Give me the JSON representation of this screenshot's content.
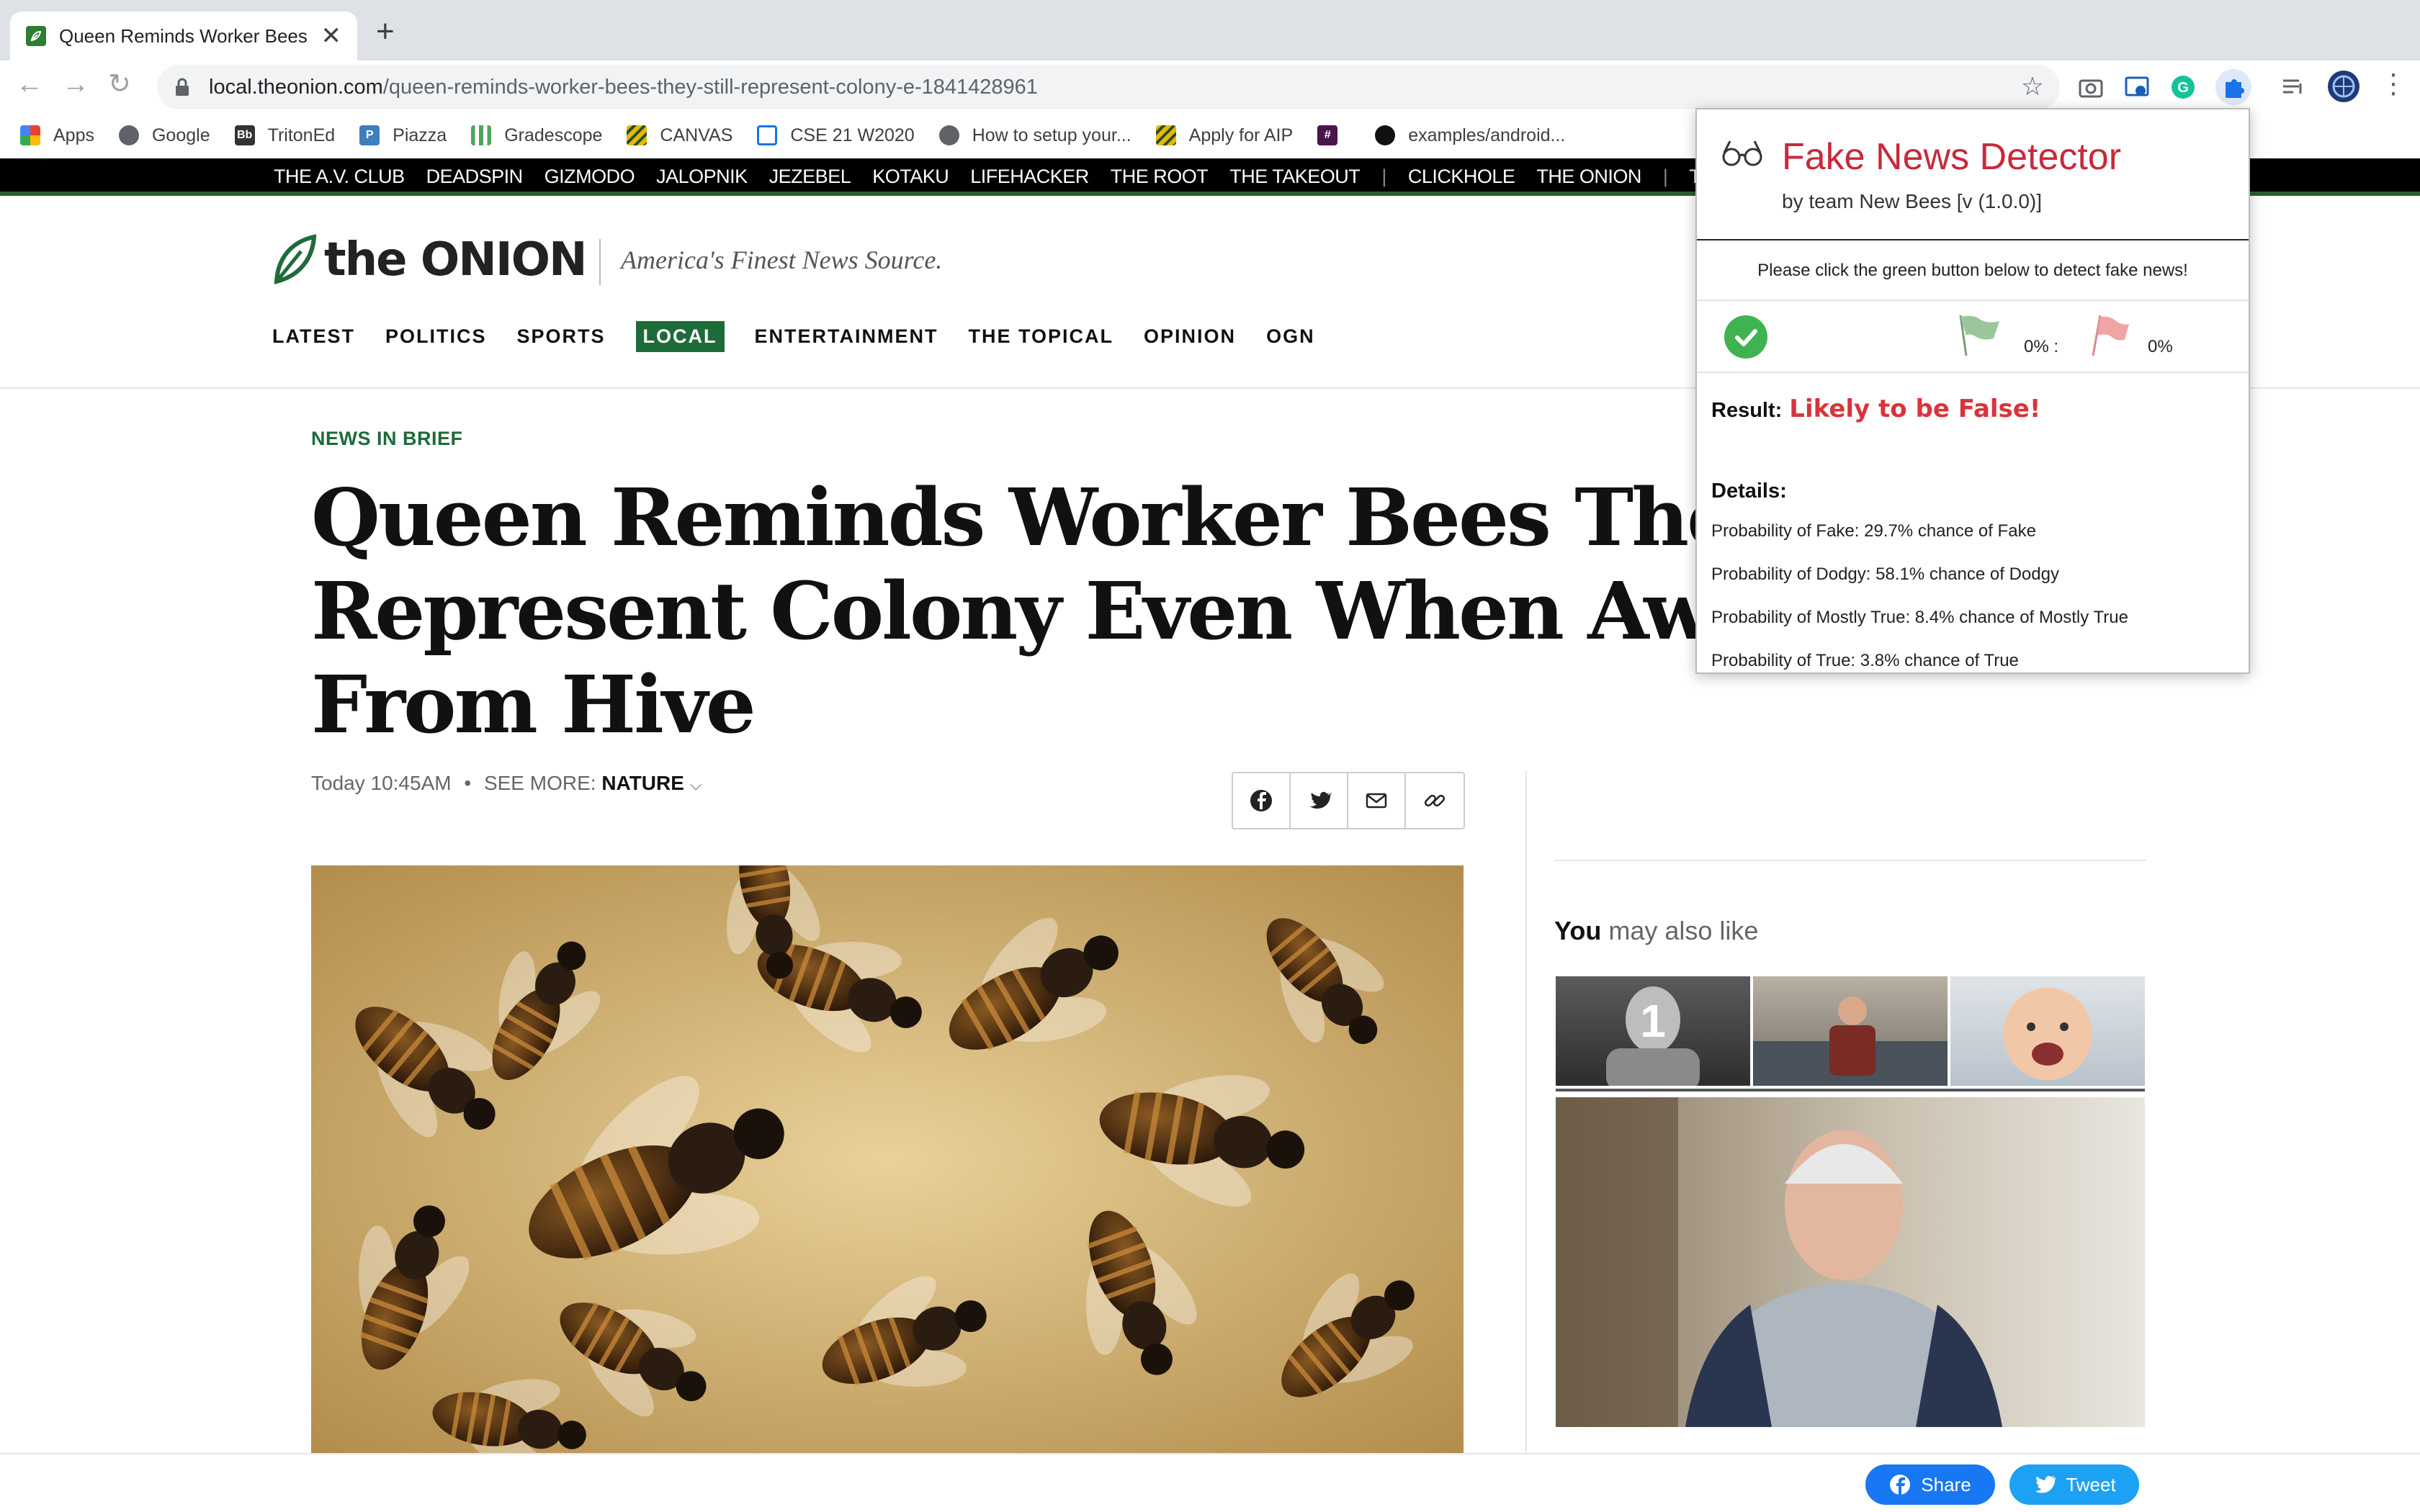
{
  "browser": {
    "tab_title": "Queen Reminds Worker Bees T",
    "tab_close": "✕",
    "new_tab": "+",
    "url_domain": "local.theonion.com",
    "url_path": "/queen-reminds-worker-bees-they-still-represent-colony-e-1841428961",
    "bookmarks": [
      {
        "label": "Apps",
        "icon": "apps-grid-icon",
        "color": "#e94235"
      },
      {
        "label": "Google",
        "icon": "globe-icon",
        "color": "#5f6368"
      },
      {
        "label": "TritonEd",
        "icon": "tritoned-icon",
        "color": "#333333"
      },
      {
        "label": "Piazza",
        "icon": "piazza-icon",
        "color": "#3e7ebd"
      },
      {
        "label": "Gradescope",
        "icon": "bar-chart-icon",
        "color": "#4ea55c"
      },
      {
        "label": "CANVAS",
        "icon": "canvas-icon",
        "color": "#e6b800"
      },
      {
        "label": "CSE 21 W2020",
        "icon": "table-icon",
        "color": "#1a73e8"
      },
      {
        "label": "How to setup your...",
        "icon": "globe-icon",
        "color": "#5f6368"
      },
      {
        "label": "Apply for AIP",
        "icon": "canvas-icon",
        "color": "#e6b800"
      },
      {
        "label": "",
        "icon": "slack-icon",
        "color": "#4a154b"
      },
      {
        "label": "examples/android...",
        "icon": "github-icon",
        "color": "#111111"
      }
    ]
  },
  "network_links": [
    "THE A.V. CLUB",
    "DEADSPIN",
    "GIZMODO",
    "JALOPNIK",
    "JEZEBEL",
    "KOTAKU",
    "LIFEHACKER",
    "THE ROOT",
    "THE TAKEOUT",
    "|",
    "CLICKHOLE",
    "THE ONION",
    "|",
    "THE INVENTORY"
  ],
  "site": {
    "logo_text": "the ONION",
    "tagline": "America's Finest News Source.",
    "nav": [
      "LATEST",
      "POLITICS",
      "SPORTS",
      "LOCAL",
      "ENTERTAINMENT",
      "THE TOPICAL",
      "OPINION",
      "OGN"
    ],
    "nav_active": "LOCAL"
  },
  "article": {
    "kicker": "NEWS IN BRIEF",
    "headline": "Queen Reminds Worker Bees They Still Represent Colony Even When Away From Hive",
    "time": "Today 10:45AM",
    "bullet": "•",
    "see_more_label": "SEE MORE:",
    "see_more_tag": "NATURE"
  },
  "sidebar": {
    "related_you": "You",
    "related_rest": " may also like",
    "badge_number": "1"
  },
  "bottom_share": {
    "share_label": "Share",
    "tweet_label": "Tweet",
    "facebook_color": "#1877f2",
    "twitter_color": "#1da1f2"
  },
  "extension": {
    "name": "Fake News Detector",
    "team": "by team New Bees [v (1.0.0)]",
    "instruction": "Please click the green button below to detect fake news!",
    "true_pct": "0% :",
    "false_pct": "0%",
    "result_label": "Result:",
    "result_value": "Likely to be False!",
    "details_label": "Details:",
    "probabilities": [
      "Probability of Fake: 29.7% chance of Fake",
      "Probability of Dodgy: 58.1% chance of Dodgy",
      "Probability of Mostly True: 8.4% chance of Mostly True",
      "Probability of True: 3.8% chance of True"
    ],
    "accent_color": "#c8293b"
  }
}
